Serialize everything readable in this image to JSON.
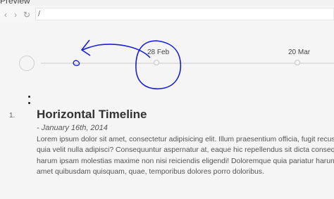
{
  "preview": {
    "label": "Preview"
  },
  "browser": {
    "back": "‹",
    "forward": "›",
    "reload": "↻",
    "address": "/"
  },
  "timeline": {
    "dates": [
      {
        "label": "28 Feb"
      },
      {
        "label": "20 Mar"
      }
    ]
  },
  "event": {
    "number": "1.",
    "title": "Horizontal Timeline",
    "date": "- January 16th, 2014",
    "lines": [
      "Lorem ipsum dolor sit amet, consectetur adipisicing elit. Illum praesentium officia, fugit recusandae",
      "quia velit nulla adipisci? Consequuntur aspernatur at, eaque hic repellendus sit dicta consequatur",
      "harum ipsam molestias maxime non nisi reiciendis eligendi! Doloremque quia pariatur harum ea",
      "amet quibusdam quisquam, quae, temporibus dolores porro doloribus."
    ]
  },
  "annotation": {
    "stroke_color": "#1a1fd6"
  }
}
